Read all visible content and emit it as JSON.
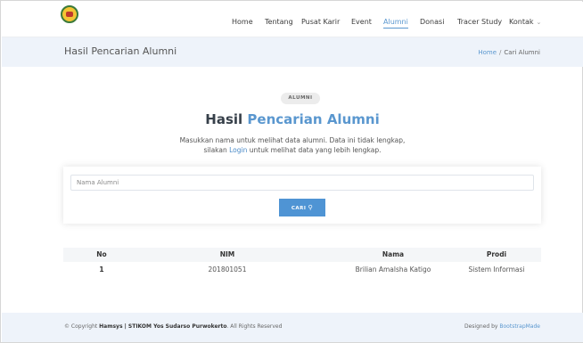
{
  "nav": {
    "items": [
      {
        "label": "Home"
      },
      {
        "label": "Tentang"
      },
      {
        "label": "Pusat Karir"
      },
      {
        "label": "Event"
      },
      {
        "label": "Alumni"
      },
      {
        "label": "Donasi"
      },
      {
        "label": "Tracer Study"
      },
      {
        "label": "Kontak"
      }
    ],
    "active": "Alumni"
  },
  "band": {
    "title": "Hasil Pencarian Alumni",
    "breadcrumb_home": "Home",
    "breadcrumb_sep": "/",
    "breadcrumb_current": "Cari Alumni"
  },
  "section": {
    "badge": "ALUMNI",
    "heading_prefix": "Hasil",
    "heading_accent": "Pencarian Alumni",
    "desc_line1": "Masukkan nama untuk melihat data alumni. Data ini tidak lengkap,",
    "desc_pre": "silakan",
    "desc_link": "Login",
    "desc_post": "untuk melihat data yang lebih lengkap."
  },
  "search": {
    "placeholder": "Nama Alumni",
    "value": "",
    "button_label": "CARI"
  },
  "table": {
    "headers": [
      "No",
      "NIM",
      "Nama",
      "Prodi"
    ],
    "rows": [
      {
        "no": "1",
        "nim": "201801051",
        "nama": "Brilian Amalsha Katigo",
        "prodi": "Sistem Informasi"
      }
    ]
  },
  "footer": {
    "copy_prefix": "© Copyright",
    "copy_brand": "Hamsys | STIKOM Yos Sudarso Purwokerto",
    "copy_suffix": ". All Rights Reserved",
    "designed_prefix": "Designed by",
    "designed_link": "BootstrapMade"
  },
  "colors": {
    "accent": "#5a97cf",
    "button": "#4f94d4",
    "band": "#eef3fa"
  }
}
